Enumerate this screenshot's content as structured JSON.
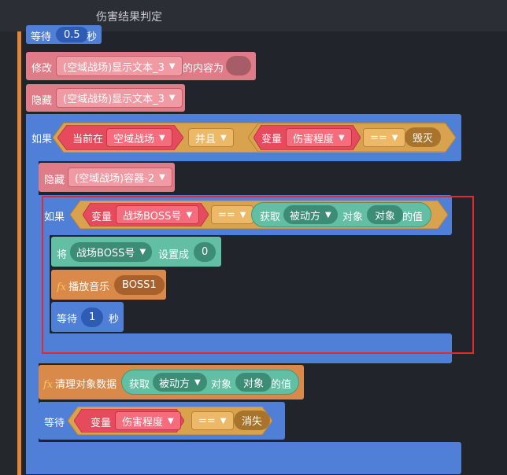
{
  "window": {
    "title": "伤害结果判定"
  },
  "blocks": {
    "wait_top": {
      "label": "等待",
      "value": "0.5",
      "unit": "秒"
    },
    "modify": {
      "label": "修改",
      "target": "(空域战场)显示文本_3",
      "suffix": "的内容为"
    },
    "hide1": {
      "label": "隐藏",
      "target": "(空域战场)显示文本_3"
    },
    "if1": {
      "label": "如果",
      "cond_left": {
        "label": "当前在",
        "dropdown": "空域战场"
      },
      "logic": "并且",
      "cond_right": {
        "label": "变量",
        "dropdown": "伤害程度",
        "op": "==",
        "value": "毁灭"
      }
    },
    "hide2": {
      "label": "隐藏",
      "target": "(空域战场)容器-2"
    },
    "if2": {
      "label": "如果",
      "var": {
        "label": "变量",
        "dropdown": "战场BOSS号"
      },
      "op": "==",
      "get": {
        "label": "获取",
        "dropdown": "被动方",
        "mid": "对象",
        "obj": "对象",
        "suffix": "的值"
      }
    },
    "set": {
      "label": "将",
      "dropdown": "战场BOSS号",
      "mid": "设置成",
      "value": "0"
    },
    "music": {
      "fx": "fx",
      "label": "播放音乐",
      "value": "BOSS1"
    },
    "wait_inner": {
      "label": "等待",
      "value": "1",
      "unit": "秒"
    },
    "clear": {
      "fx": "fx",
      "label": "清理对象数据",
      "get": {
        "label": "获取",
        "dropdown": "被动方",
        "mid": "对象",
        "obj": "对象",
        "suffix": "的值"
      }
    },
    "wait_bottom": {
      "label": "等待",
      "var_label": "变量",
      "dropdown": "伤害程度",
      "op": "==",
      "value": "消失"
    }
  },
  "colors": {
    "control": "#4f7fd6",
    "looks": "#df7c88",
    "sound": "#d98a4a",
    "operator": "#d9a24e",
    "sensing": "#e54b5d",
    "data": "#62bfa3",
    "highlight": "#e3282e"
  },
  "icons": {
    "dropdown": "triangle-down-icon",
    "fx": "function-icon"
  }
}
